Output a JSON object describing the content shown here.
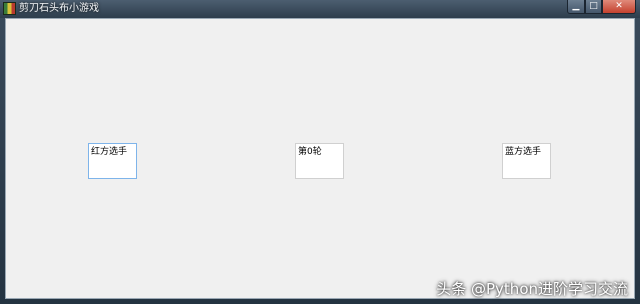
{
  "window": {
    "title": "剪刀石头布小游戏",
    "controls": {
      "minimize": "▁",
      "maximize": "□",
      "close": "✕"
    }
  },
  "labels": {
    "red_player": "红方选手",
    "round": "第0轮",
    "blue_player": "蓝方选手"
  },
  "watermark": "头条 @Python进阶学习交流",
  "icons": {
    "app": "game-icon"
  }
}
